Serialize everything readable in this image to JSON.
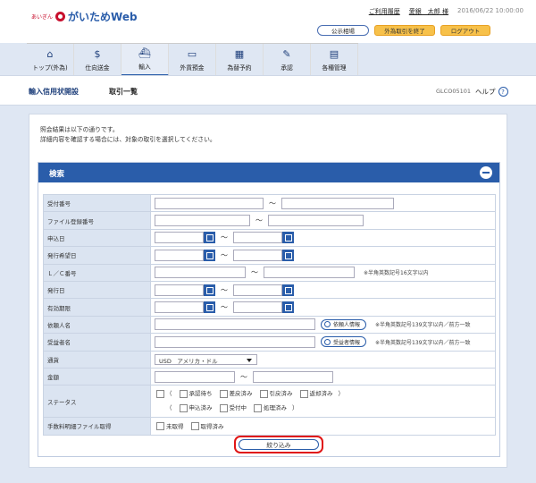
{
  "brand": {
    "small": "あいぎん",
    "name": "がいためWeb"
  },
  "header": {
    "history": "ご利用履歴",
    "user": "愛銀　太郎 様",
    "timestamp": "2016/06/22 10:00:00",
    "buttons": {
      "rates": "公示相場",
      "end_fx": "外為取引を終了",
      "logout": "ログアウト"
    }
  },
  "nav": [
    {
      "label": "トップ(外為)",
      "icon": "home-icon"
    },
    {
      "label": "仕向送金",
      "icon": "remittance-icon"
    },
    {
      "label": "輸入",
      "icon": "import-ship-icon"
    },
    {
      "label": "外貨預金",
      "icon": "deposit-icon"
    },
    {
      "label": "為替予約",
      "icon": "reservation-icon"
    },
    {
      "label": "承認",
      "icon": "approval-icon"
    },
    {
      "label": "各種管理",
      "icon": "management-icon"
    }
  ],
  "subheader": {
    "title": "輸入信用状開設",
    "subtitle": "取引一覧",
    "screen_id": "GLCO05101",
    "help": "ヘルプ",
    "help_icon": "?"
  },
  "message": {
    "line1": "照会結果は以下の通りです。",
    "line2": "詳細内容を確認する場合には、対象の取引を選択してください。"
  },
  "search": {
    "title": "検索",
    "labels": [
      "受付番号",
      "ファイル登録番号",
      "申込日",
      "発行希望日",
      "Ｌ／Ｃ番号",
      "発行日",
      "有効期限",
      "依頼人名",
      "受益者名",
      "通貨",
      "金額",
      "ステータス",
      "手数料明細ファイル取得"
    ],
    "tilde": "～",
    "lc_note": "※半角英数記号16文字以内",
    "applicant_btn": "依頼人情報",
    "applicant_note": "※半角英数記号139文字以内／前方一致",
    "beneficiary_btn": "受益者情報",
    "beneficiary_note": "※半角英数記号139文字以内／前方一致",
    "currency": "USD　アメリカ・ドル",
    "status1": [
      "（",
      "承認待ち",
      "差戻済み",
      "引戻済み",
      "返却済み",
      "）"
    ],
    "status2": [
      "（",
      "申込済み",
      "受付中",
      "処理済み",
      "）"
    ],
    "fee1": "未取得",
    "fee2": "取得済み",
    "submit": "絞り込み"
  }
}
